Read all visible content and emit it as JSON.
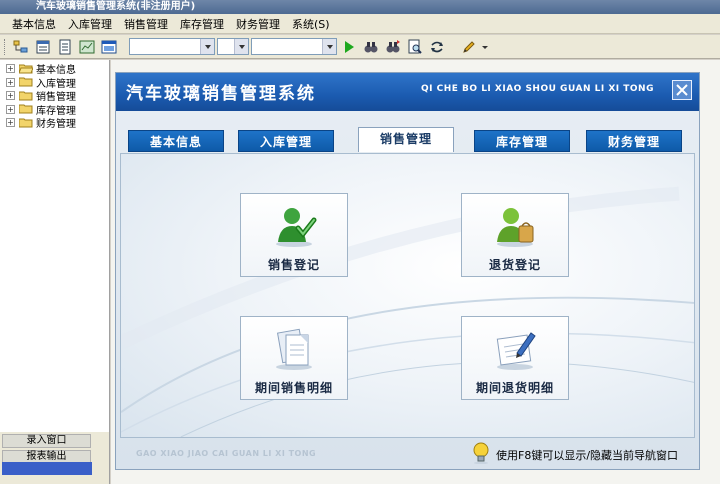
{
  "window": {
    "title": "汽车玻璃销售管理系统(非注册用户)"
  },
  "menubar": {
    "items": [
      "基本信息",
      "入库管理",
      "销售管理",
      "库存管理",
      "财务管理",
      "系统(S)"
    ]
  },
  "tree": {
    "items": [
      {
        "label": "基本信息",
        "open": true
      },
      {
        "label": "入库管理"
      },
      {
        "label": "销售管理"
      },
      {
        "label": "库存管理"
      },
      {
        "label": "财务管理"
      }
    ]
  },
  "left_bottom": {
    "buttons": [
      "录入窗口",
      "报表输出"
    ]
  },
  "panel": {
    "title": "汽车玻璃销售管理系统",
    "subtitle": "QI CHE BO LI XIAO SHOU GUAN LI XI TONG",
    "tabs": [
      "基本信息",
      "入库管理",
      "销售管理",
      "库存管理",
      "财务管理"
    ],
    "active_tab": 2,
    "cards": [
      "销售登记",
      "退货登记",
      "期间销售明细",
      "期间退货明细"
    ],
    "footer_pinyin": "GAO XIAO JIAO CAI GUAN LI XI TONG",
    "footer_hint": "使用F8键可以显示/隐藏当前导航窗口"
  },
  "icons": {
    "close": "close-icon",
    "sales": "user-check-icon",
    "returns": "user-bag-icon",
    "sales_detail": "documents-icon",
    "returns_detail": "edit-document-icon",
    "hint": "lightbulb-icon"
  },
  "colors": {
    "accent": "#1b5bb0",
    "tab": "#0e5aa8",
    "panel_bg": "#e8eef4"
  }
}
